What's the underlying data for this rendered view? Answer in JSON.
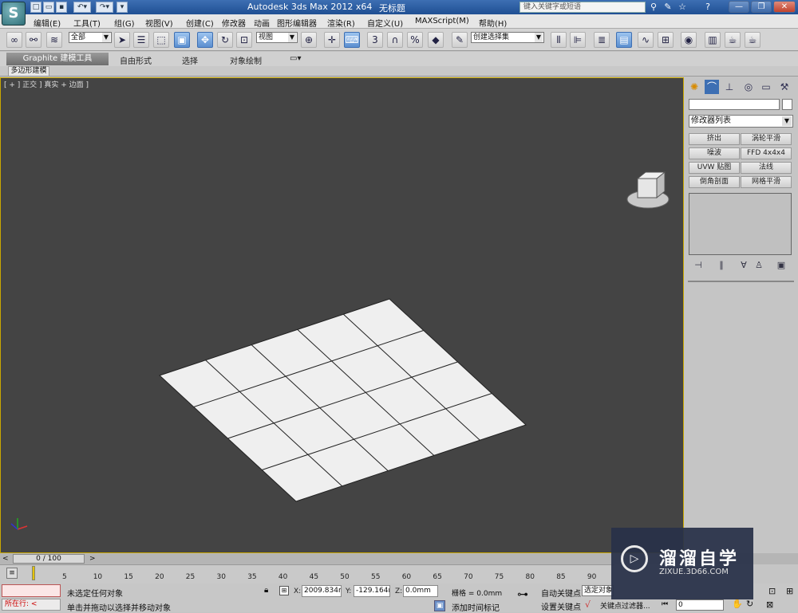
{
  "titlebar": {
    "app_title": "Autodesk 3ds Max  2012 x64",
    "doc_title": "无标题",
    "search_placeholder": "键入关键字或短语",
    "help_label": "?"
  },
  "menu": {
    "items": [
      "编辑(E)",
      "工具(T)",
      "组(G)",
      "视图(V)",
      "创建(C)",
      "修改器",
      "动画",
      "图形编辑器",
      "渲染(R)",
      "自定义(U)",
      "MAXScript(M)",
      "帮助(H)"
    ]
  },
  "toolbar": {
    "selection_filter": "全部",
    "ref_coord": "视图",
    "named_selection": "创建选择集",
    "snap_label": "3"
  },
  "ribbon": {
    "tabs": [
      "Graphite 建模工具",
      "自由形式",
      "选择",
      "对象绘制"
    ],
    "subtab": "多边形建模"
  },
  "viewport": {
    "label": "[ + ] 正交 ] 真实 + 边面 ]",
    "plane": {
      "segments_length": 4,
      "segments_width": 5
    }
  },
  "command_panel": {
    "modifier_list": "修改器列表",
    "modifier_buttons": [
      "挤出",
      "涡轮平滑",
      "噪波",
      "FFD 4x4x4",
      "UVW 贴图",
      "法线",
      "倒角剖面",
      "网格平滑"
    ]
  },
  "timeline": {
    "slider": "0 / 100",
    "ticks": [
      "5",
      "10",
      "15",
      "20",
      "25",
      "30",
      "35",
      "40",
      "45",
      "50",
      "55",
      "60",
      "65",
      "70",
      "75",
      "80",
      "85",
      "90"
    ]
  },
  "status": {
    "running_label": "所在行:",
    "selection_status": "未选定任何对象",
    "prompt": "单击并拖动以选择并移动对象",
    "x_label": "X:",
    "x_value": "2009.834m",
    "y_label": "Y:",
    "y_value": "-129.164m",
    "z_label": "Z:",
    "z_value": "0.0mm",
    "grid": "栅格 = 0.0mm",
    "add_time_tag": "添加时间标记",
    "auto_key": "自动关键点",
    "set_key": "设置关键点",
    "selected": "选定对象",
    "key_filters": "关键点过滤器...",
    "frame": "0"
  },
  "watermark": {
    "title": "溜溜自学",
    "url": "ZIXUE.3D66.COM"
  }
}
